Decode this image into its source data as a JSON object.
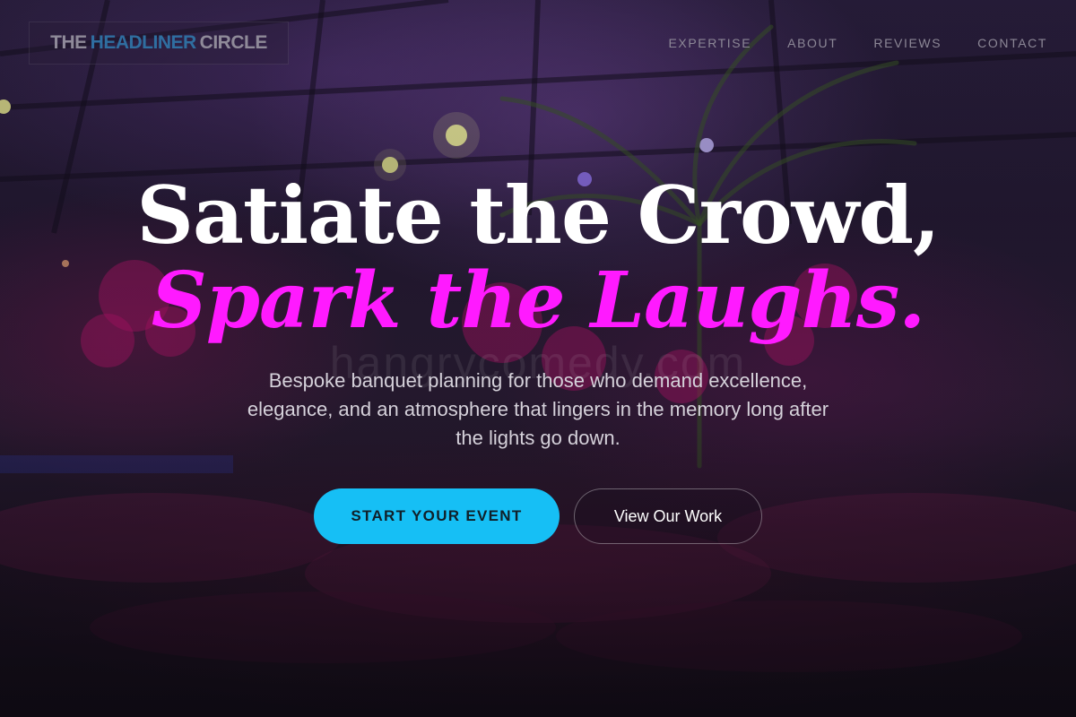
{
  "brand": {
    "word1": "THE",
    "word2": "HEADLINER",
    "word3": "CIRCLE"
  },
  "nav": {
    "items": [
      {
        "label": "EXPERTISE"
      },
      {
        "label": "ABOUT"
      },
      {
        "label": "REVIEWS"
      },
      {
        "label": "CONTACT"
      }
    ]
  },
  "hero": {
    "title_line1": "Satiate the Crowd,",
    "title_line2": "Spark the Laughs.",
    "background_watermark": "hangrycomedy.com",
    "subtitle": "Bespoke banquet planning for those who demand excellence, elegance, and an atmosphere that lingers in the memory long after the lights go down.",
    "primary_cta": "START YOUR EVENT",
    "secondary_cta": "View Our Work"
  },
  "colors": {
    "accent_magenta": "#ff1aff",
    "accent_cyan": "#16bff5",
    "logo_blue": "#2f6ea0",
    "background": "#1f1626"
  }
}
